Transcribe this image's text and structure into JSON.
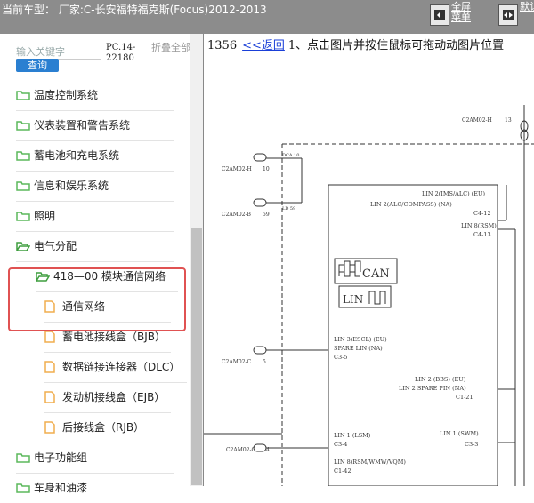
{
  "header": {
    "title": "当前车型： 厂家:C-长安福特福克斯(Focus)2012-2013",
    "fullscreen_label": "全屏菜单",
    "second_label": "默认"
  },
  "sidebar": {
    "search_placeholder": "输入关键字",
    "query_label": "查询",
    "pc_code": "PC.14-22180",
    "collapse_label": "折叠全部",
    "items": [
      {
        "label": "温度控制系统"
      },
      {
        "label": "仪表装置和警告系统"
      },
      {
        "label": "蓄电池和充电系统"
      },
      {
        "label": "信息和娱乐系统"
      },
      {
        "label": "照明"
      },
      {
        "label": "电气分配"
      },
      {
        "label": "418—00 模块通信网络"
      },
      {
        "label": "通信网络"
      },
      {
        "label": "蓄电池接线盒（BJB）"
      },
      {
        "label": "数据链接连接器（DLC）"
      },
      {
        "label": "发动机接线盒（EJB）"
      },
      {
        "label": "后接线盒（RJB）"
      },
      {
        "label": "电子功能组"
      },
      {
        "label": "车身和油漆"
      }
    ]
  },
  "content": {
    "page_number": "1356",
    "back_label": "<<返回",
    "instruction": "1、点击图片并按住鼠标可拖动动图片位置"
  },
  "diagram": {
    "c2am02_h_top": "C2AM02-H",
    "c2am02_h_top_pin": "13",
    "c2am02_h": "C2AM02-H",
    "c2am02_h_pin": "10",
    "c2am02_b": "C2AM02-B",
    "c2am02_b_pin": "59",
    "c2am02_c": "C2AM02-C",
    "c2am02_c_pin": "5",
    "c2am02_c2": "C2AM02-C",
    "c2am02_c2_pin": "4",
    "wire1": "DCA 10",
    "wire2": "LD 59",
    "lin2_ims": "LIN 2(IMS/ALC) (EU)",
    "lin2_alc": "LIN 2(ALC/COMPASS) (NA)",
    "c4_12": "C4-12",
    "lin8_rsm": "LIN 8(RSM)",
    "c4_13": "C4-13",
    "can_label": "CAN",
    "lin_label": "LIN",
    "lin3_escl": "LIN 3(ESCL) (EU)",
    "spare_lin": "SPARE LIN (NA)",
    "c3_5": "C3-5",
    "lin2_bbs": "LIN 2 (BBS) (EU)",
    "lin2_spare": "LIN 2 SPARE PIN (NA)",
    "c1_21": "C1-21",
    "lin1_lsm": "LIN 1 (LSM)",
    "c3_4": "C3-4",
    "lin1_swm": "LIN 1 (SWM)",
    "c3_3": "C3-3",
    "lin8_rsm_wmw": "LIN 8(RSM/WMW/VQM)",
    "c1_42": "C1-42"
  },
  "colors": {
    "topbar": "#8c8c8c",
    "folder": "#5cb85c",
    "folder_open": "#3f9e3f",
    "file": "#f0ad4e",
    "link": "#1a3fd8",
    "highlight": "#e05252",
    "query_button": "#2a7fd1"
  }
}
